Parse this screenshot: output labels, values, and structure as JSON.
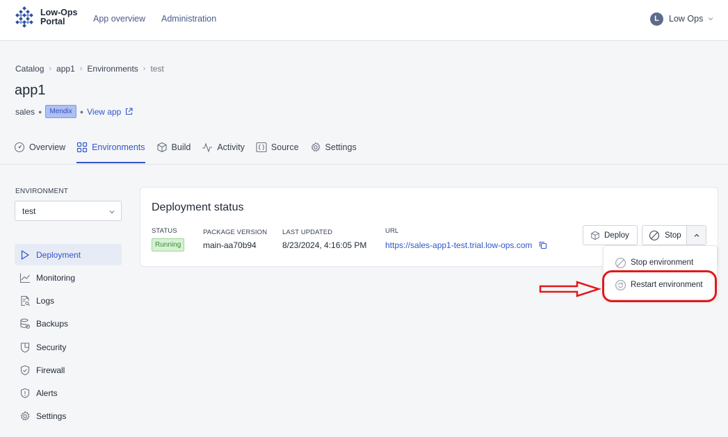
{
  "brand": {
    "line1": "Low-Ops",
    "line2": "Portal"
  },
  "topnav": {
    "links": [
      "App overview",
      "Administration"
    ]
  },
  "user": {
    "initial": "L",
    "name": "Low Ops"
  },
  "breadcrumb": [
    "Catalog",
    "app1",
    "Environments",
    "test"
  ],
  "app": {
    "title": "app1",
    "team": "sales",
    "platform_badge": "Mendix",
    "view_app": "View app"
  },
  "tabs": [
    {
      "label": "Overview",
      "icon": "dashboard-icon"
    },
    {
      "label": "Environments",
      "icon": "grid-icon",
      "active": true
    },
    {
      "label": "Build",
      "icon": "box-icon"
    },
    {
      "label": "Activity",
      "icon": "activity-icon"
    },
    {
      "label": "Source",
      "icon": "code-braces-icon"
    },
    {
      "label": "Settings",
      "icon": "gear-icon"
    }
  ],
  "sidebar": {
    "environment_label": "ENVIRONMENT",
    "environment_value": "test",
    "items": [
      {
        "label": "Deployment",
        "icon": "play-icon",
        "active": true
      },
      {
        "label": "Monitoring",
        "icon": "chart-line-icon"
      },
      {
        "label": "Logs",
        "icon": "file-search-icon"
      },
      {
        "label": "Backups",
        "icon": "database-icon"
      },
      {
        "label": "Security",
        "icon": "shield-icon"
      },
      {
        "label": "Firewall",
        "icon": "shield-check-icon"
      },
      {
        "label": "Alerts",
        "icon": "alert-shield-icon"
      },
      {
        "label": "Settings",
        "icon": "gear-icon"
      }
    ]
  },
  "deployment": {
    "title": "Deployment status",
    "status_label": "STATUS",
    "status_value": "Running",
    "package_label": "PACKAGE VERSION",
    "package_value": "main-aa70b94",
    "updated_label": "LAST UPDATED",
    "updated_value": "8/23/2024, 4:16:05 PM",
    "url_label": "URL",
    "url_value": "https://sales-app1-test.trial.low-ops.com",
    "deploy_button": "Deploy",
    "stop_button": "Stop"
  },
  "menu": {
    "items": [
      {
        "label": "Stop environment",
        "icon": "stop-circle-icon"
      },
      {
        "label": "Restart environment",
        "icon": "restart-icon"
      }
    ]
  },
  "colors": {
    "accent": "#2f56c8",
    "annotation": "#e01a1a",
    "running": "#3e8a38"
  }
}
